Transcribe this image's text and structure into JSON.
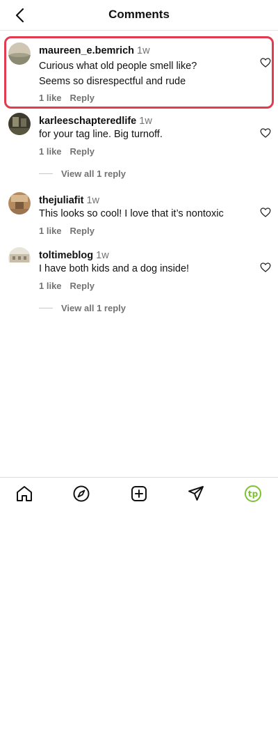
{
  "header": {
    "title": "Comments"
  },
  "comments": [
    {
      "username": "maureen_e.bemrich",
      "time": "1w",
      "text": "Curious what old people smell like?",
      "text2": "Seems so disrespectful and rude",
      "likes": "1 like",
      "reply": "Reply"
    },
    {
      "username": "karleeschapteredlife",
      "time": "1w",
      "text": "for your tag line. Big turnoff.",
      "likes": "1 like",
      "reply": "Reply",
      "view_replies": "View all 1 reply"
    },
    {
      "username": "thejuliafit",
      "time": "1w",
      "text": "This looks so cool! I love that it’s nontoxic",
      "likes": "1 like",
      "reply": "Reply"
    },
    {
      "username": "toltimeblog",
      "time": "1w",
      "text": "I have both kids and a dog inside!",
      "likes": "1 like",
      "reply": "Reply",
      "view_replies": "View all 1 reply"
    }
  ],
  "tabs": [
    {
      "icon": "home-icon"
    },
    {
      "icon": "compass-icon"
    },
    {
      "icon": "add-post-icon"
    },
    {
      "icon": "send-icon"
    },
    {
      "icon": "profile-tp-icon",
      "label": "tp"
    }
  ],
  "colors": {
    "highlight": "#e23a4e",
    "muted": "#737373",
    "profile_accent": "#7cc133"
  }
}
